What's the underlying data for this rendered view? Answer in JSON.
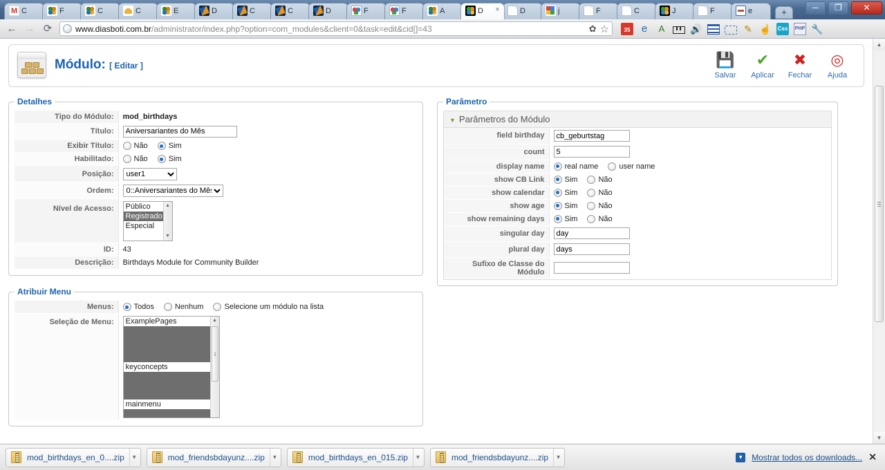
{
  "browser": {
    "tabs": [
      {
        "label": "C",
        "icon": "gmail-icon",
        "favclass": "fav-gmail",
        "active": false
      },
      {
        "label": "F",
        "icon": "joomla-icon",
        "favclass": "fav-joomla",
        "active": false
      },
      {
        "label": "C",
        "icon": "joomla-icon",
        "favclass": "fav-joomla",
        "active": false
      },
      {
        "label": "C",
        "icon": "helmet-icon",
        "favclass": "fav-helmet",
        "active": false
      },
      {
        "label": "E",
        "icon": "joomla-icon",
        "favclass": "fav-joomla",
        "active": false
      },
      {
        "label": "D",
        "icon": "site-icon",
        "favclass": "fav-dark-blue",
        "active": false
      },
      {
        "label": "C",
        "icon": "site-icon",
        "favclass": "fav-dark-blue",
        "active": false
      },
      {
        "label": "C",
        "icon": "site-icon",
        "favclass": "fav-dark-blue",
        "active": false
      },
      {
        "label": "D",
        "icon": "site-icon",
        "favclass": "fav-dark-blue",
        "active": false
      },
      {
        "label": "F",
        "icon": "photo-icon",
        "favclass": "fav-pic",
        "active": false
      },
      {
        "label": "F",
        "icon": "photo-icon",
        "favclass": "fav-pic",
        "active": false
      },
      {
        "label": "A",
        "icon": "joomla-icon",
        "favclass": "fav-joomla",
        "active": false
      },
      {
        "label": "D",
        "icon": "joomla-icon",
        "favclass": "fav-joomla-dark",
        "active": true,
        "close": "×"
      },
      {
        "label": "D",
        "icon": "document-icon",
        "favclass": "fav-doc",
        "active": false
      },
      {
        "label": "j",
        "icon": "google-icon",
        "favclass": "fav-google",
        "active": false
      },
      {
        "label": "F",
        "icon": "document-icon",
        "favclass": "fav-doc",
        "active": false
      },
      {
        "label": "C",
        "icon": "document-icon",
        "favclass": "fav-doc",
        "active": false
      },
      {
        "label": "J",
        "icon": "joomla-icon",
        "favclass": "fav-joomla-dark",
        "active": false
      },
      {
        "label": "F",
        "icon": "document-icon",
        "favclass": "fav-doc",
        "active": false
      },
      {
        "label": "e",
        "icon": "dots-icon",
        "favclass": "fav-dots",
        "active": false
      }
    ],
    "new_tab_label": "+",
    "window_buttons": {
      "minimize": "─",
      "maximize": "❐",
      "close": "✕"
    },
    "nav": {
      "back": "←",
      "forward": "→",
      "reload": "⟳",
      "url_host": "www.diasboti.com.br",
      "url_path": "/administrator/index.php?option=com_modules&client=0&task=edit&cid[]=43",
      "bookmark_star": "☆",
      "page_action": "✿"
    },
    "extensions": [
      {
        "name": "calendar-icon",
        "class": "ei-cal",
        "glyph": "35"
      },
      {
        "name": "ie-tab-icon",
        "class": "ei-ie",
        "glyph": "e"
      },
      {
        "name": "translate-icon",
        "class": "ei-trans",
        "glyph": "A"
      },
      {
        "name": "ruler-icon",
        "class": "ei-ruler",
        "glyph": ""
      },
      {
        "name": "speaker-icon",
        "class": "ei-spk",
        "glyph": "🔊"
      },
      {
        "name": "outline-icon",
        "class": "ei-list",
        "glyph": ""
      },
      {
        "name": "resolution-icon",
        "class": "ei-frame",
        "glyph": ""
      },
      {
        "name": "notes-icon",
        "class": "ei-note",
        "glyph": "✎"
      },
      {
        "name": "hand-icon",
        "class": "ei-hand",
        "glyph": "☝"
      },
      {
        "name": "css-icon",
        "class": "ei-css",
        "glyph": "Css"
      },
      {
        "name": "php-icon",
        "class": "ei-php",
        "glyph": "PHP"
      },
      {
        "name": "wrench-icon",
        "class": "ei-wrench",
        "glyph": "🔧"
      }
    ]
  },
  "header": {
    "title": "Módulo:",
    "subtitle": "[ Editar ]",
    "toolbar": [
      {
        "label": "Salvar",
        "icon": "save-icon",
        "glyph": "💾",
        "color": "#333"
      },
      {
        "label": "Aplicar",
        "icon": "apply-check-icon",
        "glyph": "✔",
        "color": "#4fa52e"
      },
      {
        "label": "Fechar",
        "icon": "close-circle-icon",
        "glyph": "✖",
        "color": "#cc2222"
      },
      {
        "label": "Ajuda",
        "icon": "help-lifering-icon",
        "glyph": "◎",
        "color": "#d12b2b"
      }
    ]
  },
  "details": {
    "legend": "Detalhes",
    "module_type_label": "Tipo do Módulo:",
    "module_type_value": "mod_birthdays",
    "title_label": "Título:",
    "title_value": "Aniversariantes do Mês",
    "show_title_label": "Exibir Título:",
    "show_title_options": [
      {
        "label": "Não",
        "selected": false
      },
      {
        "label": "Sim",
        "selected": true
      }
    ],
    "enabled_label": "Habilitado:",
    "enabled_options": [
      {
        "label": "Não",
        "selected": false
      },
      {
        "label": "Sim",
        "selected": true
      }
    ],
    "position_label": "Posição:",
    "position_value": "user1",
    "order_label": "Ordem:",
    "order_value": "0::Aniversariantes do Mês",
    "access_label": "Nível de Acesso:",
    "access_options": [
      {
        "label": "Público",
        "selected": false
      },
      {
        "label": "Registrado",
        "selected": true
      },
      {
        "label": "Especial",
        "selected": false
      }
    ],
    "id_label": "ID:",
    "id_value": "43",
    "description_label": "Descrição:",
    "description_value": "Birthdays Module for Community Builder"
  },
  "assign_menu": {
    "legend": "Atribuir Menu",
    "menus_label": "Menus:",
    "menus_options": [
      {
        "label": "Todos",
        "selected": true
      },
      {
        "label": "Nenhum",
        "selected": false
      },
      {
        "label": "Selecione um módulo na lista",
        "selected": false
      }
    ],
    "selection_label": "Seleção de Menu:",
    "menu_items": [
      {
        "label": "ExamplePages",
        "selected": false
      },
      {
        "label": "",
        "selected": true
      },
      {
        "label": "keyconcepts",
        "selected": false
      },
      {
        "label": "",
        "selected": true
      },
      {
        "label": "mainmenu",
        "selected": false
      },
      {
        "label": "",
        "selected": true
      }
    ]
  },
  "parameters": {
    "legend": "Parâmetro",
    "panel_title": "Parâmetros do Módulo",
    "rows": [
      {
        "label": "field birthday",
        "type": "text",
        "value": "cb_geburtstag"
      },
      {
        "label": "count",
        "type": "text",
        "value": "5"
      },
      {
        "label": "display name",
        "type": "radio",
        "options": [
          {
            "label": "real name",
            "selected": true
          },
          {
            "label": "user name",
            "selected": false
          }
        ]
      },
      {
        "label": "show CB Link",
        "type": "radio",
        "options": [
          {
            "label": "Sim",
            "selected": true
          },
          {
            "label": "Não",
            "selected": false
          }
        ]
      },
      {
        "label": "show calendar",
        "type": "radio",
        "options": [
          {
            "label": "Sim",
            "selected": true
          },
          {
            "label": "Não",
            "selected": false
          }
        ]
      },
      {
        "label": "show age",
        "type": "radio",
        "options": [
          {
            "label": "Sim",
            "selected": true
          },
          {
            "label": "Não",
            "selected": false
          }
        ]
      },
      {
        "label": "show remaining days",
        "type": "radio",
        "options": [
          {
            "label": "Sim",
            "selected": true
          },
          {
            "label": "Não",
            "selected": false
          }
        ]
      },
      {
        "label": "singular day",
        "type": "text",
        "value": "day"
      },
      {
        "label": "plural day",
        "type": "text",
        "value": "days"
      },
      {
        "label": "Sufixo de Classe do Módulo",
        "type": "text",
        "value": ""
      }
    ]
  },
  "downloads": {
    "items": [
      {
        "name": "mod_birthdays_en_0....zip"
      },
      {
        "name": "mod_friendsbdayunz....zip"
      },
      {
        "name": "mod_birthdays_en_015.zip"
      },
      {
        "name": "mod_friendsbdayunz....zip"
      }
    ],
    "show_all_label": "Mostrar todos os downloads...",
    "close_label": "✕",
    "caret": "▼"
  }
}
